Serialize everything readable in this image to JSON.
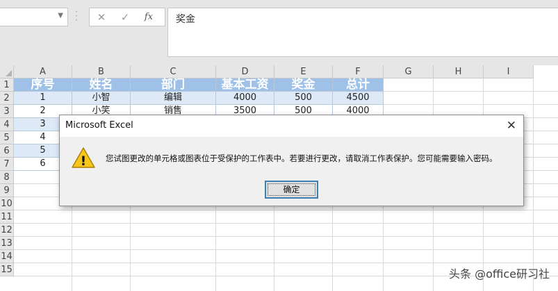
{
  "formula_bar": {
    "name_box_value": "",
    "cancel_glyph": "✕",
    "enter_glyph": "✓",
    "fx_label": "fx",
    "formula_text": "奖金"
  },
  "grid": {
    "columns": [
      "A",
      "B",
      "C",
      "D",
      "E",
      "F",
      "G",
      "H",
      "I"
    ],
    "rows": [
      "1",
      "2",
      "3",
      "4",
      "5",
      "6",
      "7",
      "8",
      "9",
      "10",
      "11",
      "12",
      "13",
      "14",
      "15"
    ],
    "table_headers": [
      "序号",
      "姓名",
      "部门",
      "基本工资",
      "奖金",
      "总计"
    ],
    "row2": [
      "1",
      "小智",
      "编辑",
      "4000",
      "500",
      "4500"
    ],
    "partial_row3": [
      "2",
      "小笑",
      "销售",
      "3500",
      "500",
      "4000"
    ],
    "visible_col_a": [
      "3",
      "4",
      "5",
      "6"
    ]
  },
  "dialog": {
    "title": "Microsoft Excel",
    "close_glyph": "✕",
    "message": "您试图更改的单元格或图表位于受保护的工作表中。若要进行更改，请取消工作表保护。您可能需要输入密码。",
    "ok_label": "确定",
    "warning_icon_symbol": "!"
  },
  "watermark": "头条 @office研习社",
  "colors": {
    "header_fill": "#9fc1e7",
    "band_fill": "#dde9f6",
    "warning_yellow": "#f7c51b"
  }
}
